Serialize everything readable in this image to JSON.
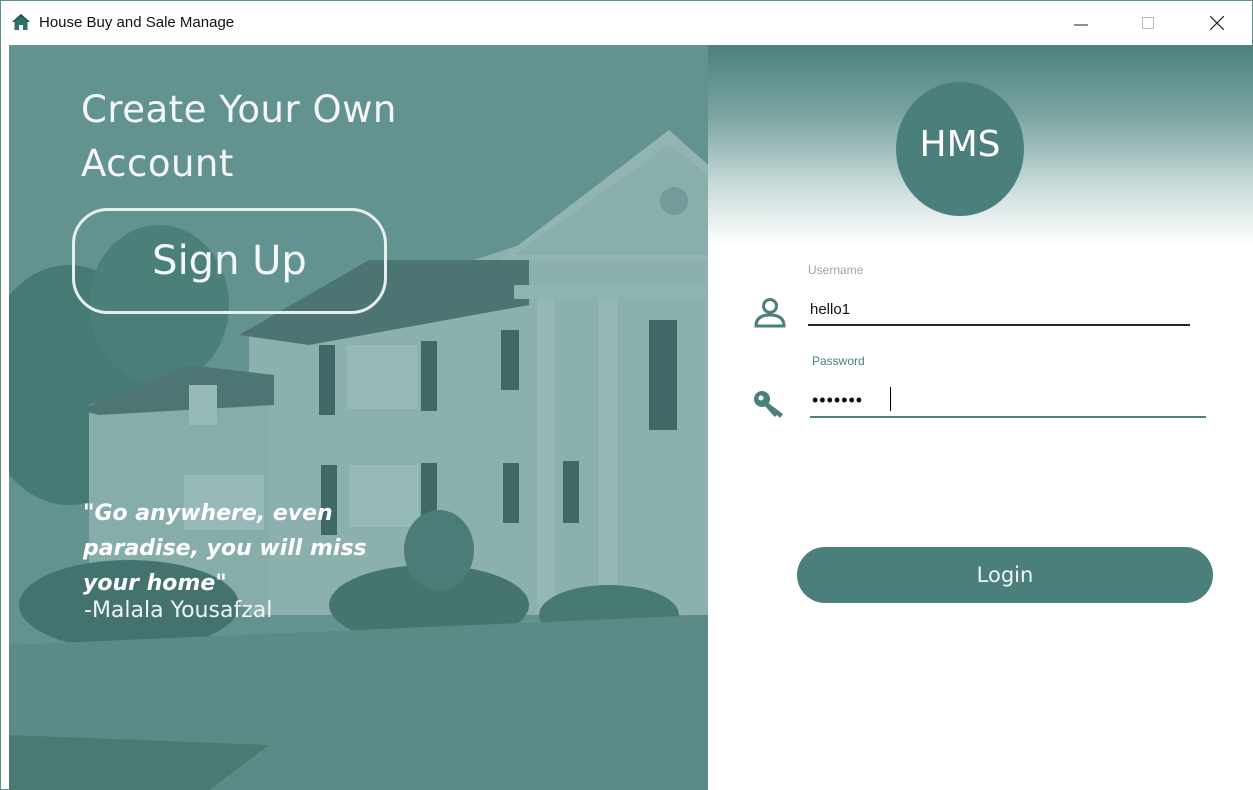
{
  "window": {
    "title": "House Buy and Sale Manage",
    "icon": "house-icon",
    "controls": [
      "minimize-icon",
      "maximize-icon",
      "close-icon"
    ]
  },
  "signup_panel": {
    "heading": "Create Your Own Account",
    "signup_label": "Sign Up",
    "quote": "\"Go anywhere, even paradise, you will miss your home\"",
    "author": "-Malala Yousafzal"
  },
  "login_panel": {
    "logo_text": "HMS",
    "username_label": "Username",
    "username_value": "hello1",
    "password_label": "Password",
    "password_value": "•••••••",
    "login_label": "Login",
    "icons": [
      "user-icon",
      "key-icon"
    ]
  },
  "colors": {
    "accent": "#4b7f7c",
    "overlay": "#5d8f8d"
  }
}
